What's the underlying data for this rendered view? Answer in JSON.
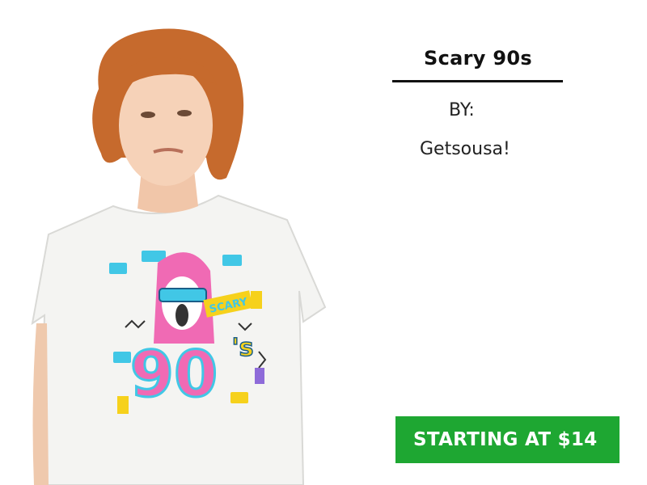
{
  "product": {
    "title": "Scary 90s",
    "by_label": "BY:",
    "artist": "Getsousa!",
    "cta_label": "STARTING AT $14"
  },
  "artwork": {
    "text_scary": "SCARY",
    "text_90": "90",
    "text_s": "'s"
  },
  "colors": {
    "cta": "#1ea732",
    "pink": "#f06ab4",
    "cyan": "#41c7e6",
    "yellow": "#f6d11c",
    "hair": "#c66a2d",
    "shirt": "#f4f4f2"
  }
}
